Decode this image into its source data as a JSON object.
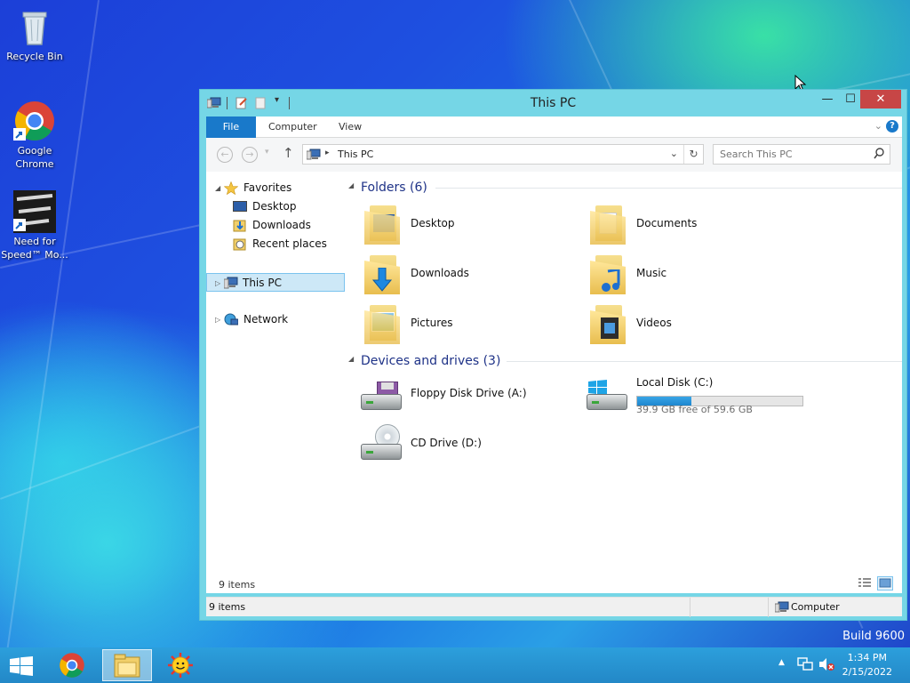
{
  "desktop": {
    "icons": [
      {
        "label": "Recycle Bin"
      },
      {
        "label": "Google Chrome"
      },
      {
        "label": "Need for Speed™ Mo..."
      }
    ],
    "watermark": "Build 9600"
  },
  "window": {
    "title": "This PC",
    "controls": {
      "minimize": "—",
      "maximize": "☐",
      "close": "✕"
    },
    "ribbon_tabs": [
      "File",
      "Computer",
      "View"
    ],
    "address": {
      "location": "This PC"
    },
    "search": {
      "placeholder": "Search This PC"
    },
    "nav_pane": {
      "favorites": "Favorites",
      "favorite_items": [
        "Desktop",
        "Downloads",
        "Recent places"
      ],
      "this_pc": "This PC",
      "network": "Network"
    },
    "folders_group": {
      "heading": "Folders (6)",
      "items": [
        "Desktop",
        "Documents",
        "Downloads",
        "Music",
        "Pictures",
        "Videos"
      ]
    },
    "devices_group": {
      "heading": "Devices and drives (3)",
      "floppy": "Floppy Disk Drive (A:)",
      "local_disk": {
        "label": "Local Disk (C:)",
        "free_text": "39.9 GB free of 59.6 GB",
        "used_fraction": 0.33
      },
      "cd_drive": "CD Drive (D:)"
    },
    "inner_status": "9 items",
    "status": {
      "items": "9 items",
      "location": "Computer"
    }
  },
  "taskbar": {
    "clock_time": "1:34 PM",
    "clock_date": "2/15/2022"
  },
  "colors": {
    "accent": "#1979ca",
    "window_frame": "#75d6e6",
    "close": "#c74646",
    "taskbar": "#2388c7"
  }
}
